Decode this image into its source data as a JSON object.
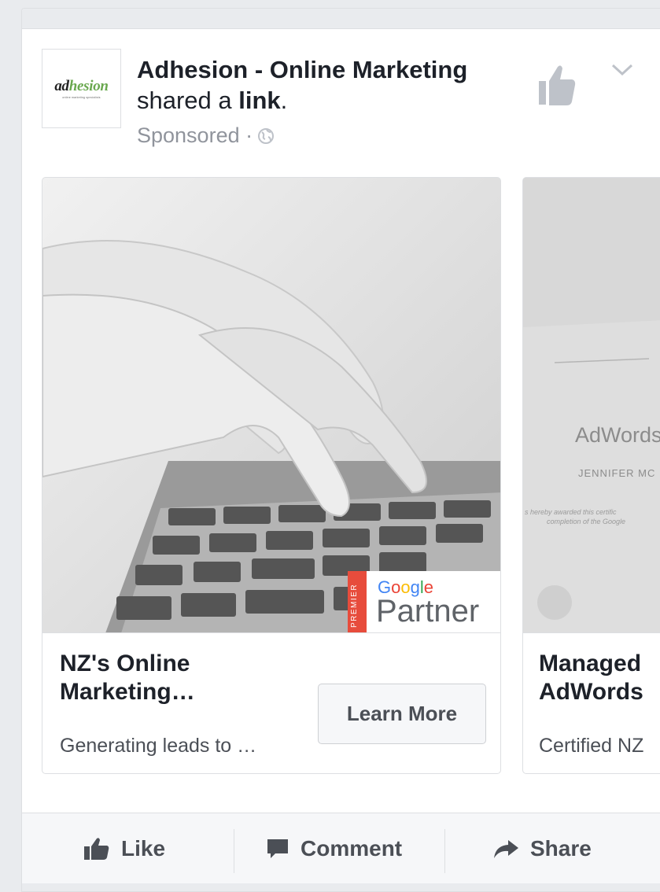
{
  "post": {
    "avatar_text_a": "ad",
    "avatar_text_b": "hesion",
    "avatar_tagline": "online marketing specialists",
    "page_name": "Adhesion - Online Marketing",
    "shared_prefix": "shared a ",
    "shared_link": "link",
    "shared_suffix": ".",
    "sponsored": "Sponsored ·"
  },
  "carousel": [
    {
      "title": "NZ's Online Marketing…",
      "description": "Generating leads to …",
      "button": "Learn More",
      "badge_premier": "PREMIER",
      "badge_google": "Google",
      "badge_partner": "Partner"
    },
    {
      "title": "Managed AdWords",
      "description": "Certified NZ",
      "image_text_title": "AdWords",
      "image_text_name": "JENNIFER MC",
      "image_text_line1": "s hereby awarded this certific",
      "image_text_line2": "completion of the Google"
    }
  ],
  "actions": {
    "like": "Like",
    "comment": "Comment",
    "share": "Share"
  },
  "colors": {
    "text_primary": "#1d2129",
    "text_secondary": "#90949c",
    "action_text": "#4b4f56",
    "badge_red": "#e74c3c",
    "page_bg": "#e9ebee"
  },
  "icons": [
    "globe-icon",
    "like-page-icon",
    "chevron-down-icon",
    "thumbs-up-icon",
    "comment-icon",
    "share-icon"
  ]
}
